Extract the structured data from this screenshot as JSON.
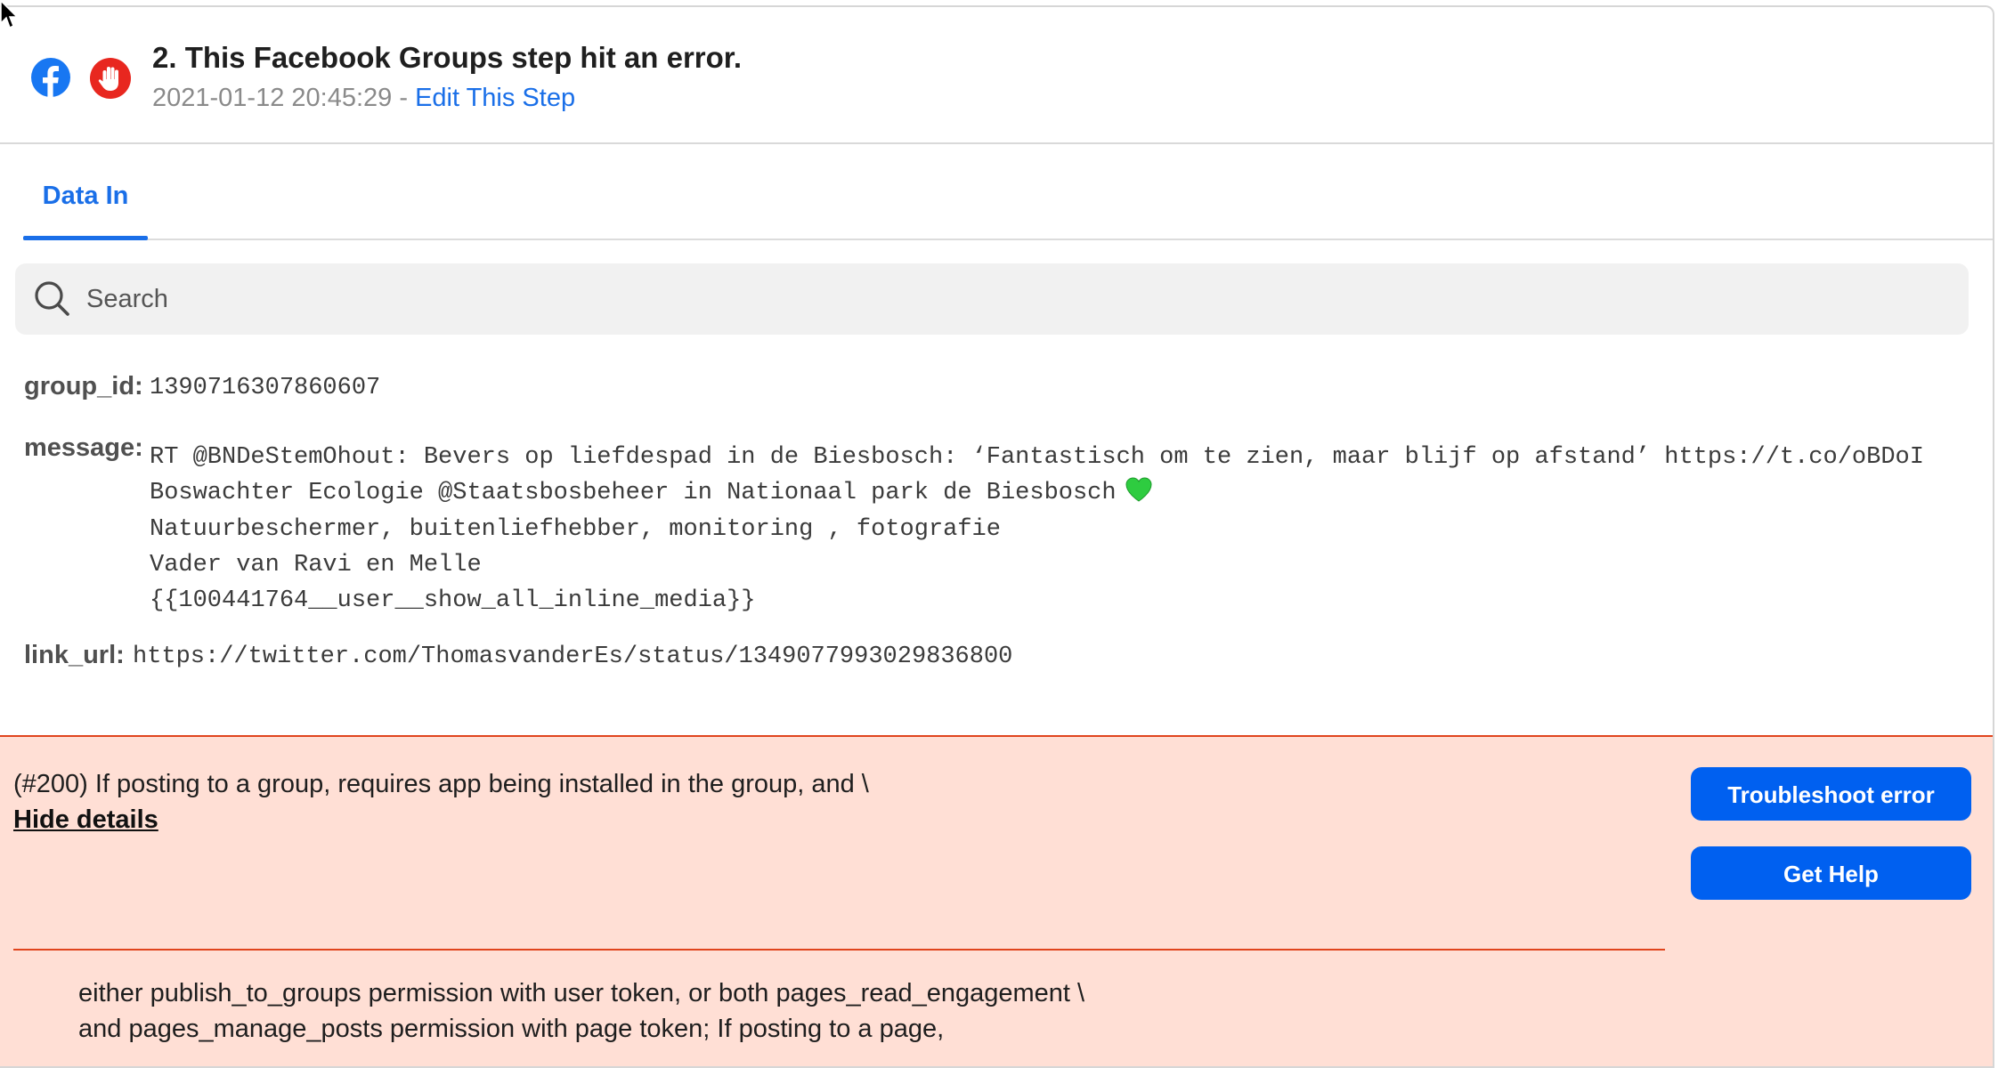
{
  "step": {
    "title": "2. This Facebook Groups step hit an error.",
    "timestamp": "2021-01-12 20:45:29",
    "separator": " - ",
    "edit_link": "Edit This Step",
    "app_icon": "facebook-icon",
    "status_icon": "stop-hand-icon"
  },
  "tabs": [
    {
      "label": "Data In",
      "active": true
    }
  ],
  "search": {
    "placeholder": "Search",
    "value": ""
  },
  "fields": {
    "group_id": {
      "label": "group_id:",
      "value": "1390716307860607"
    },
    "message": {
      "label": "message:",
      "lines": [
        "RT @BNDeStemOhout: Bevers op liefdespad in de Biesbosch: ‘Fantastisch om te zien, maar blijf op afstand’ https://t.co/oBDoI",
        "Boswachter Ecologie @Staatsbosbeheer in Nationaal park de Biesbosch",
        "Natuurbeschermer, buitenliefhebber, monitoring , fotografie",
        "Vader van Ravi en Melle",
        "{{100441764__user__show_all_inline_media}}"
      ],
      "emoji_icon": "green-heart-icon"
    },
    "link_url": {
      "label": "link_url:",
      "value": "https://twitter.com/ThomasvanderEs/status/1349077993029836800"
    }
  },
  "error": {
    "summary": "(#200) If posting to a group, requires app being installed in the group, and \\",
    "hide_details": "Hide details",
    "troubleshoot_label": "Troubleshoot error",
    "help_label": "Get Help",
    "details": [
      "either publish_to_groups permission with user token, or both pages_read_engagement \\",
      "and pages_manage_posts permission with page token; If posting to a page,"
    ]
  },
  "colors": {
    "accent": "#1a6fe8",
    "button": "#0060f0",
    "error_bg": "#ffdfd5",
    "error_border": "#e0441d",
    "facebook": "#1877f2",
    "stop": "#e8271f"
  }
}
